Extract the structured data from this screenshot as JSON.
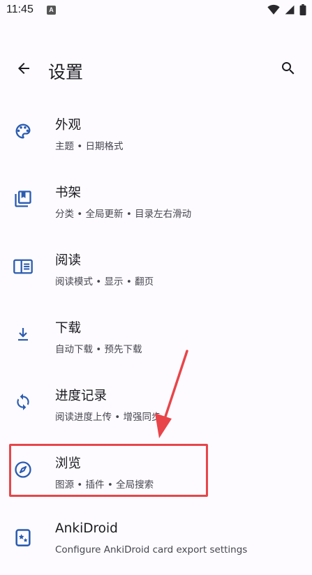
{
  "status_bar": {
    "time": "11:45",
    "notification_icon": "A"
  },
  "toolbar": {
    "title": "设置",
    "back_icon": "arrow-back-icon",
    "search_icon": "search-icon"
  },
  "settings": [
    {
      "title": "外观",
      "subtitle": "主题 • 日期格式",
      "icon": "palette-icon"
    },
    {
      "title": "书架",
      "subtitle": "分类 • 全局更新 • 目录左右滑动",
      "icon": "bookshelf-icon"
    },
    {
      "title": "阅读",
      "subtitle": "阅读模式 • 显示 • 翻页",
      "icon": "book-open-icon"
    },
    {
      "title": "下载",
      "subtitle": "自动下载 • 预先下载",
      "icon": "download-icon"
    },
    {
      "title": "进度记录",
      "subtitle": "阅读进度上传 • 增强同步",
      "icon": "sync-icon"
    },
    {
      "title": "浏览",
      "subtitle": "图源 • 插件 • 全局搜索",
      "icon": "compass-icon"
    },
    {
      "title": "AnkiDroid",
      "subtitle": "Configure AnkiDroid card export settings",
      "icon": "anki-icon"
    }
  ],
  "colors": {
    "accent": "#2b5cb0",
    "highlight": "#e8454a",
    "background": "#fdfbff"
  }
}
